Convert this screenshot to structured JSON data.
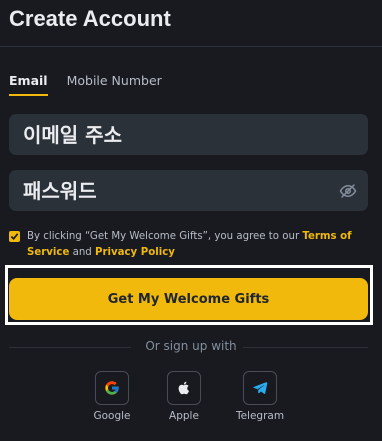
{
  "header": {
    "title": "Create Account"
  },
  "tabs": [
    {
      "label": "Email",
      "active": true
    },
    {
      "label": "Mobile Number",
      "active": false
    }
  ],
  "form": {
    "email_placeholder": "이메일 주소",
    "password_placeholder": "패스워드",
    "password_toggle_icon": "eye-off-icon"
  },
  "consent": {
    "checked": true,
    "text_before": "By clicking “Get My Welcome Gifts”, you agree to our ",
    "terms_link": "Terms of Service",
    "and_text": " and ",
    "privacy_link": "Privacy Policy"
  },
  "cta": {
    "label": "Get My Welcome Gifts"
  },
  "social": {
    "divider_text": "Or sign up with",
    "providers": [
      {
        "label": "Google",
        "icon": "google-icon"
      },
      {
        "label": "Apple",
        "icon": "apple-icon"
      },
      {
        "label": "Telegram",
        "icon": "telegram-icon"
      }
    ]
  },
  "colors": {
    "background": "#181a20",
    "input_bg": "#2b3139",
    "accent": "#f0b90b",
    "text_primary": "#eaecef",
    "text_secondary": "#b7bdc6"
  }
}
